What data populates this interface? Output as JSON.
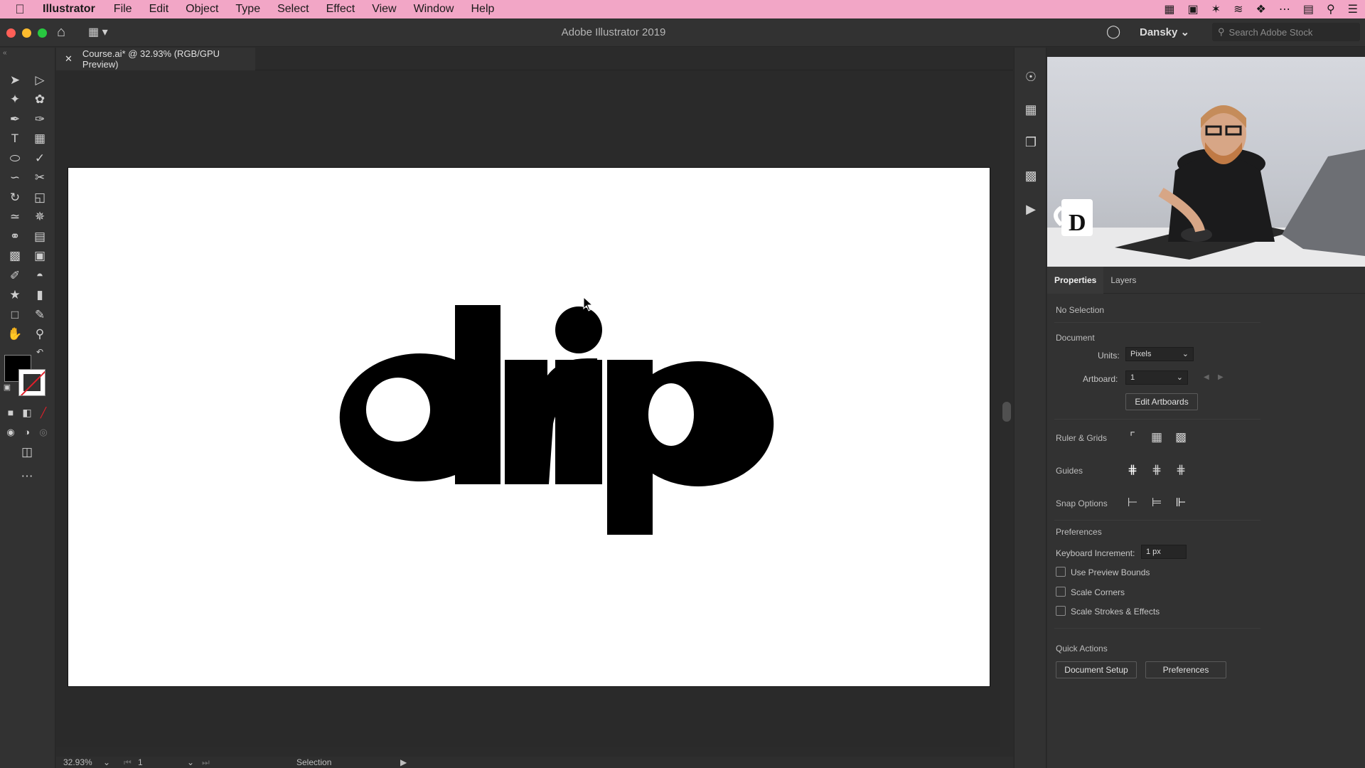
{
  "menubar": {
    "app_name": "Illustrator",
    "items": [
      "File",
      "Edit",
      "Object",
      "Type",
      "Select",
      "Effect",
      "View",
      "Window",
      "Help"
    ]
  },
  "titlebar": {
    "title": "Adobe Illustrator 2019",
    "workspace": "Dansky",
    "search_placeholder": "Search Adobe Stock"
  },
  "document": {
    "tab_label": "Course.ai* @ 32.93% (RGB/GPU Preview)",
    "artwork_text": "drip"
  },
  "statusbar": {
    "zoom": "32.93%",
    "artboard": "1",
    "tool": "Selection"
  },
  "properties": {
    "tabs": [
      "Properties",
      "Layers"
    ],
    "selection_state": "No Selection",
    "document_section": "Document",
    "units_label": "Units:",
    "units_value": "Pixels",
    "artboard_label": "Artboard:",
    "artboard_value": "1",
    "edit_artboards": "Edit Artboards",
    "ruler_grids": "Ruler & Grids",
    "guides": "Guides",
    "snap_options": "Snap Options",
    "preferences_section": "Preferences",
    "keyboard_increment_label": "Keyboard Increment:",
    "keyboard_increment_value": "1 px",
    "use_preview_bounds": "Use Preview Bounds",
    "scale_corners": "Scale Corners",
    "scale_strokes": "Scale Strokes & Effects",
    "quick_actions": "Quick Actions",
    "document_setup": "Document Setup",
    "preferences_button": "Preferences"
  },
  "colors": {
    "menubar": "#f2a6c6",
    "panel": "#323232",
    "canvas": "#2a2a2a",
    "artboard": "#ffffff",
    "artwork": "#000000"
  }
}
